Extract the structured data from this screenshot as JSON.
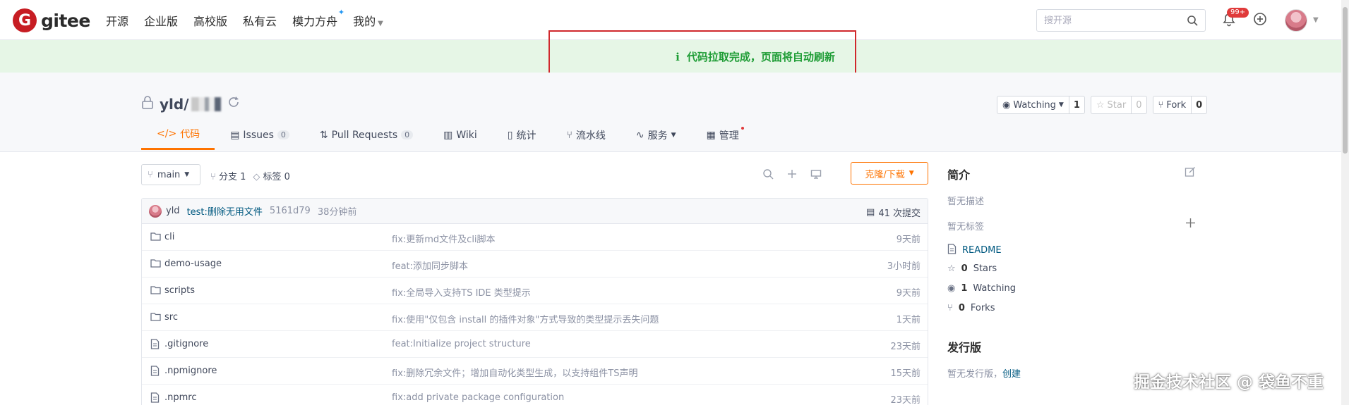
{
  "brand": {
    "logo_letter": "G",
    "name": "gitee"
  },
  "nav": [
    {
      "label": "开源"
    },
    {
      "label": "企业版"
    },
    {
      "label": "高校版"
    },
    {
      "label": "私有云"
    },
    {
      "label": "模力方舟"
    },
    {
      "label": "我的"
    }
  ],
  "search": {
    "placeholder": "搜开源"
  },
  "notifications": {
    "badge": "99+"
  },
  "toast": {
    "message": "代码拉取完成，页面将自动刷新",
    "icon": "i",
    "color": "#1f9d36"
  },
  "repo": {
    "title": "yld/",
    "watch": {
      "label": "Watching",
      "count": "1"
    },
    "star": {
      "label": "Star",
      "count": "0"
    },
    "fork": {
      "label": "Fork",
      "count": "0"
    }
  },
  "tabs": [
    {
      "label": "代码",
      "count": ""
    },
    {
      "label": "Issues",
      "count": "0"
    },
    {
      "label": "Pull Requests",
      "count": "0"
    },
    {
      "label": "Wiki",
      "count": ""
    },
    {
      "label": "统计",
      "count": ""
    },
    {
      "label": "流水线",
      "count": ""
    },
    {
      "label": "服务",
      "count": ""
    },
    {
      "label": "管理",
      "count": ""
    }
  ],
  "toolbar": {
    "branch": "main",
    "branches": "分支 1",
    "tags": "标签 0",
    "clone": "克隆/下载"
  },
  "commit": {
    "author": "yld",
    "message": "test:删除无用文件",
    "sha": "5161d79",
    "ago": "38分钟前",
    "count": "41 次提交"
  },
  "files": [
    {
      "type": "folder",
      "name": "cli",
      "message": "fix:更新md文件及cli脚本",
      "time": "9天前"
    },
    {
      "type": "folder",
      "name": "demo-usage",
      "message": "feat:添加同步脚本",
      "time": "3小时前"
    },
    {
      "type": "folder",
      "name": "scripts",
      "message": "fix:全局导入支持TS IDE 类型提示",
      "time": "9天前"
    },
    {
      "type": "folder",
      "name": "src",
      "message": "fix:使用\"仅包含 install 的插件对象\"方式导致的类型提示丢失问题",
      "time": "1天前"
    },
    {
      "type": "file",
      "name": ".gitignore",
      "message": "feat:Initialize project structure",
      "time": "23天前"
    },
    {
      "type": "file",
      "name": ".npmignore",
      "message": "fix:删除冗余文件；增加自动化类型生成，以支持组件TS声明",
      "time": "15天前"
    },
    {
      "type": "file",
      "name": ".npmrc",
      "message": "fix:add private package configuration",
      "time": "23天前"
    }
  ],
  "sidebar": {
    "intro_title": "简介",
    "no_desc": "暂无描述",
    "no_tags": "暂无标签",
    "readme": "README",
    "stars": {
      "count": "0",
      "label": "Stars"
    },
    "watching": {
      "count": "1",
      "label": "Watching"
    },
    "forks": {
      "count": "0",
      "label": "Forks"
    },
    "release_title": "发行版",
    "no_release": "暂无发行版，",
    "create": "创建"
  },
  "watermark": "掘金技术社区 @ 袋鱼不重",
  "colors": {
    "accent": "#fe7300",
    "link": "#005980",
    "brand": "#c71d23"
  }
}
